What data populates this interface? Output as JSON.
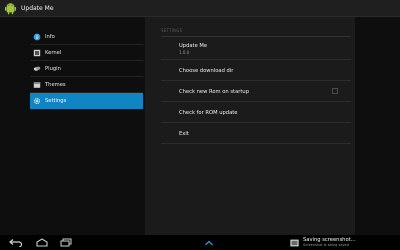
{
  "action_bar": {
    "title": "Update Me",
    "icon": "android-robot-icon"
  },
  "left_nav": {
    "items": [
      {
        "label": "Info",
        "icon": "info-icon",
        "selected": false
      },
      {
        "label": "Kernel",
        "icon": "kernel-icon",
        "selected": false
      },
      {
        "label": "Plugin",
        "icon": "plugin-icon",
        "selected": false
      },
      {
        "label": "Themes",
        "icon": "themes-icon",
        "selected": false
      },
      {
        "label": "Settings",
        "icon": "settings-icon",
        "selected": true
      }
    ]
  },
  "settings": {
    "section_header": "SETTINGS",
    "items": [
      {
        "title": "Update Me",
        "summary": "1.0.0"
      },
      {
        "title": "Choose download dir",
        "summary": ""
      },
      {
        "title": "Check new Rom on startup",
        "summary": "",
        "checkbox": true,
        "checked": false
      },
      {
        "title": "Check for ROM update",
        "summary": ""
      },
      {
        "title": "Exit",
        "summary": ""
      }
    ]
  },
  "system_bar": {
    "nav_icons": [
      "back-icon",
      "home-icon",
      "recent-apps-icon",
      "up-arrow-icon"
    ],
    "notification": {
      "icon": "screenshot-icon",
      "title": "Saving screenshot...",
      "subtitle": "Screenshot is being saved"
    }
  },
  "colors": {
    "accent": "#0f85c4",
    "action_bar_bg": "#1f1f1f",
    "panel_bg": "#1b1b1b",
    "system_bar_bg": "#000000"
  }
}
